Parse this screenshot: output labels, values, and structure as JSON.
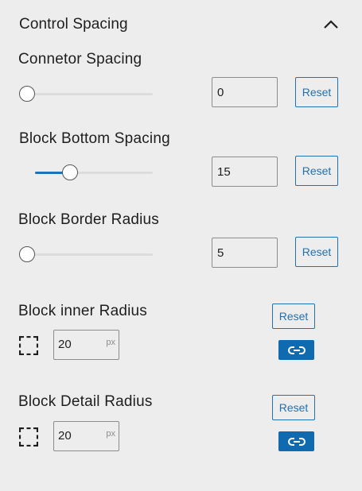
{
  "panel": {
    "title": "Control Spacing",
    "collapse_icon": "chevron-up-icon"
  },
  "controls": {
    "connector_spacing": {
      "label": "Connetor Spacing",
      "value": "0",
      "slider_fraction": 0.0,
      "reset_label": "Reset"
    },
    "block_bottom_spacing": {
      "label": "Block Bottom Spacing",
      "value": "15",
      "slider_fraction": 0.3,
      "reset_label": "Reset"
    },
    "block_border_radius": {
      "label": "Block Border Radius",
      "value": "5",
      "slider_fraction": 0.0,
      "reset_label": "Reset"
    },
    "block_inner_radius": {
      "label": "Block inner Radius",
      "value": "20",
      "unit": "px",
      "reset_label": "Reset",
      "link_icon": "link-icon",
      "corner_icon": "border-radius-corners-icon"
    },
    "block_detail_radius": {
      "label": "Block Detail Radius",
      "value": "20",
      "unit": "px",
      "reset_label": "Reset",
      "link_icon": "link-icon",
      "corner_icon": "border-radius-corners-icon"
    }
  },
  "colors": {
    "accent": "#2271b1",
    "link_button": "#0f6ab0",
    "background": "#ededed"
  }
}
